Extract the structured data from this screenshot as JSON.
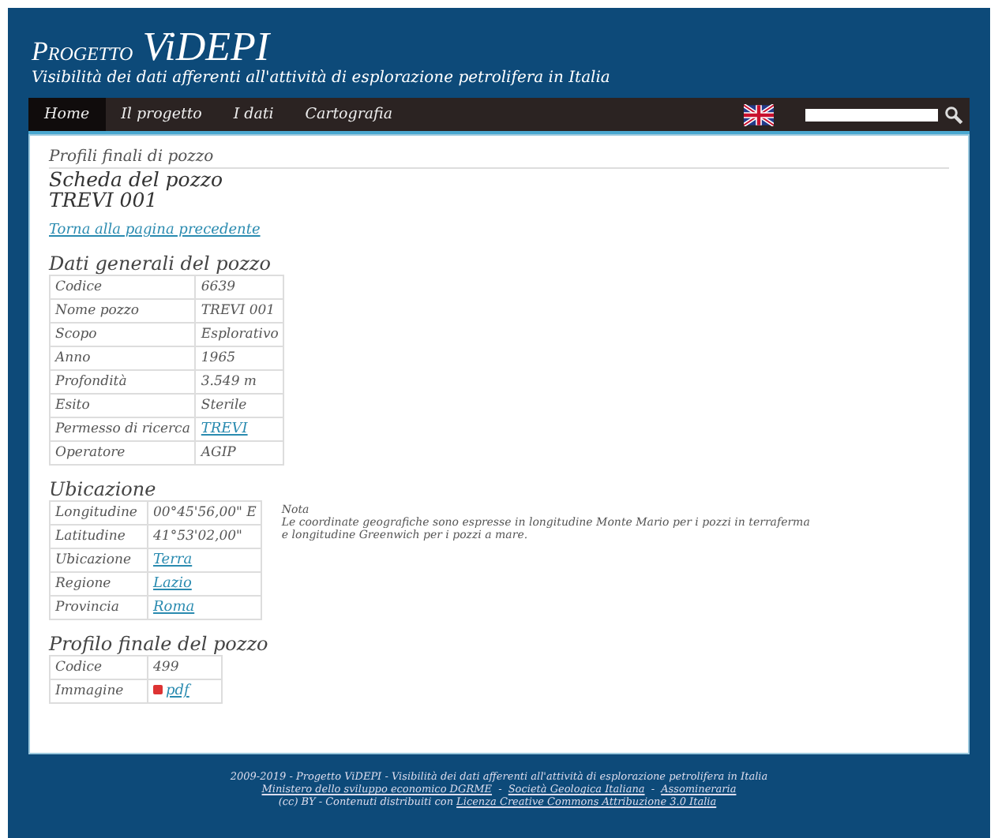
{
  "header": {
    "title_prefix": "Progetto",
    "title_main": "ViDEPI",
    "subtitle": "Visibilità dei dati afferenti all'attività di esplorazione petrolifera in Italia"
  },
  "nav": [
    {
      "label": "Home",
      "selected": true
    },
    {
      "label": "Il progetto",
      "selected": false
    },
    {
      "label": "I dati",
      "selected": false
    },
    {
      "label": "Cartografia",
      "selected": false
    }
  ],
  "breadcrumb": "Profili finali di pozzo",
  "page_title": "Scheda del pozzo",
  "well_name": "TREVI 001",
  "back_link": "Torna alla pagina precedente",
  "sections": [
    {
      "title": "Dati generali del pozzo",
      "rows": [
        {
          "label": "Codice",
          "value": "6639",
          "kind": "text"
        },
        {
          "label": "Nome pozzo",
          "value": "TREVI 001",
          "kind": "text"
        },
        {
          "label": "Scopo",
          "value": "Esplorativo",
          "kind": "text"
        },
        {
          "label": "Anno",
          "value": "1965",
          "kind": "text"
        },
        {
          "label": "Profondità",
          "value": "3.549 m",
          "kind": "text"
        },
        {
          "label": "Esito",
          "value": "Sterile",
          "kind": "text"
        },
        {
          "label": "Permesso di ricerca",
          "value": "TREVI",
          "kind": "link"
        },
        {
          "label": "Operatore",
          "value": "AGIP",
          "kind": "text"
        }
      ]
    },
    {
      "title": "Ubicazione",
      "note_title": "Nota",
      "note": "Le coordinate geografiche sono espresse in longitudine Monte Mario per i pozzi in terraferma\ne longitudine Greenwich per i pozzi a mare.",
      "rows": [
        {
          "label": "Longitudine",
          "value": "00°45'56,00\" E",
          "kind": "text"
        },
        {
          "label": "Latitudine",
          "value": "41°53'02,00\"",
          "kind": "text"
        },
        {
          "label": "Ubicazione",
          "value": "Terra",
          "kind": "link"
        },
        {
          "label": "Regione",
          "value": "Lazio",
          "kind": "link"
        },
        {
          "label": "Provincia",
          "value": "Roma",
          "kind": "link"
        }
      ]
    },
    {
      "title": "Profilo finale del pozzo",
      "rows": [
        {
          "label": "Codice",
          "value": "499",
          "kind": "text"
        },
        {
          "label": "Immagine",
          "value": "pdf",
          "kind": "file"
        }
      ]
    }
  ],
  "footer": [
    [
      {
        "text": "2009-2019 - Progetto ViDEPI - Visibilità dei dati afferenti all'attività di esplorazione petrolifera in Italia",
        "link": false
      }
    ],
    [
      {
        "text": "Ministero dello sviluppo economico DGRME",
        "link": true
      },
      {
        "text": " - ",
        "link": false
      },
      {
        "text": "Società Geologica Italiana",
        "link": true
      },
      {
        "text": " - ",
        "link": false
      },
      {
        "text": "Assomineraria",
        "link": true
      }
    ],
    [
      {
        "text": "(cc) BY - Contenuti distribuiti con",
        "link": false
      },
      {
        "text": "Licenza Creative Commons Attribuzione 3.0 Italia",
        "link": true
      }
    ]
  ]
}
